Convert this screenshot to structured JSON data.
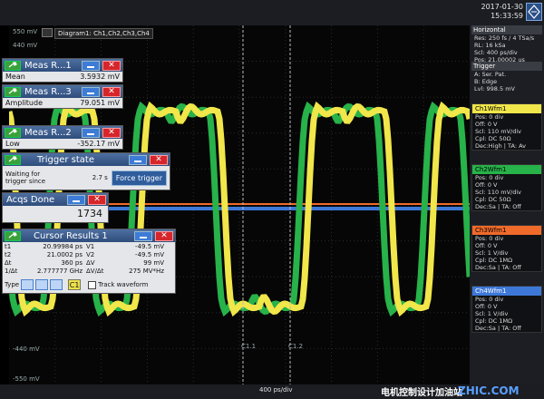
{
  "header": {
    "date": "2017-01-30",
    "time": "15:33:59"
  },
  "diagram": {
    "title": "Diagram1: Ch1,Ch2,Ch3,Ch4",
    "y_labels": [
      "550 mV",
      "440 mV",
      "-440 mV",
      "-550 mV"
    ],
    "cursor_labels": [
      "C1.1",
      "C1.2"
    ],
    "timebase": "400 ps/div"
  },
  "meas1": {
    "title": "Meas R...1",
    "label": "Mean",
    "value": "3.5932 mV"
  },
  "meas2": {
    "title": "Meas R...3",
    "label": "Amplitude",
    "value": "79.051 mV"
  },
  "meas3": {
    "title": "Meas R...2",
    "label": "Low",
    "value": "-352.17 mV"
  },
  "trigger_state": {
    "title": "Trigger state",
    "label_line1": "Waiting for",
    "label_line2": "trigger since",
    "time": "2.7 s",
    "force_label": "Force trigger"
  },
  "acqs": {
    "title": "Acqs Done",
    "value": "1734"
  },
  "cursor_results": {
    "title": "Cursor Results 1",
    "rows": [
      {
        "k1": "t1",
        "v1": "20.99984 ps",
        "k2": "V1",
        "v2": "-49.5 mV"
      },
      {
        "k1": "t2",
        "v1": "21.0002 ps",
        "k2": "V2",
        "v2": "-49.5 mV"
      },
      {
        "k1": "Δt",
        "v1": "360 ps",
        "k2": "ΔV",
        "v2": "99 mV"
      },
      {
        "k1": "1/Δt",
        "v1": "2.777777 GHz",
        "k2": "ΔV/Δt",
        "v2": "275 MV*Hz"
      }
    ],
    "type_label": "Type",
    "c1_label": "C1",
    "track_label": "Track waveform"
  },
  "right_panel": {
    "horizontal": {
      "title": "Horizontal",
      "lines": [
        "Res: 250 fs / 4 TSa/s",
        "RL: 16 kSa",
        "Scl: 400 ps/div",
        "Pos: 21.00002 us"
      ]
    },
    "trigger": {
      "title": "Trigger",
      "lines": [
        "A:    Ser. Pat.",
        "B:    Edge",
        "Lvl: 998.5 mV"
      ],
      "badge": "Norma"
    },
    "channels": [
      {
        "title": "Ch1Wfm1",
        "color": "#f1e64a",
        "lines": [
          "Pos: 0 div",
          "Off: 0 V",
          "Scl: 110 mV/div",
          "Cpl: DC 50Ω",
          "Dec:High | TA: Av"
        ]
      },
      {
        "title": "Ch2Wfm1",
        "color": "#27b24a",
        "lines": [
          "Pos: 0 div",
          "Off: 0 V",
          "Scl: 110 mV/div",
          "Cpl: DC 50Ω",
          "Dec:Sa | TA: Off"
        ]
      },
      {
        "title": "Ch3Wfm1",
        "color": "#f06a2a",
        "lines": [
          "Pos: 0 div",
          "Off: 0 V",
          "Scl: 1 V/div",
          "Cpl: DC 1MΩ",
          "Dec:Sa | TA: Off"
        ]
      },
      {
        "title": "Ch4Wfm1",
        "color": "#3d78d8",
        "lines": [
          "Pos: 0 div",
          "Off: 0 V",
          "Scl: 1 V/div",
          "Cpl: DC 1MΩ",
          "Dec:Sa | TA: Off"
        ]
      }
    ]
  },
  "watermark": {
    "text": "电机控制设计加油站",
    "site": "ZHIC.COM"
  },
  "colors": {
    "ch1": "#f1e64a",
    "ch2": "#27b24a",
    "ch3": "#f06a2a",
    "ch4": "#3d78d8",
    "accent": "#2f4d7c"
  }
}
